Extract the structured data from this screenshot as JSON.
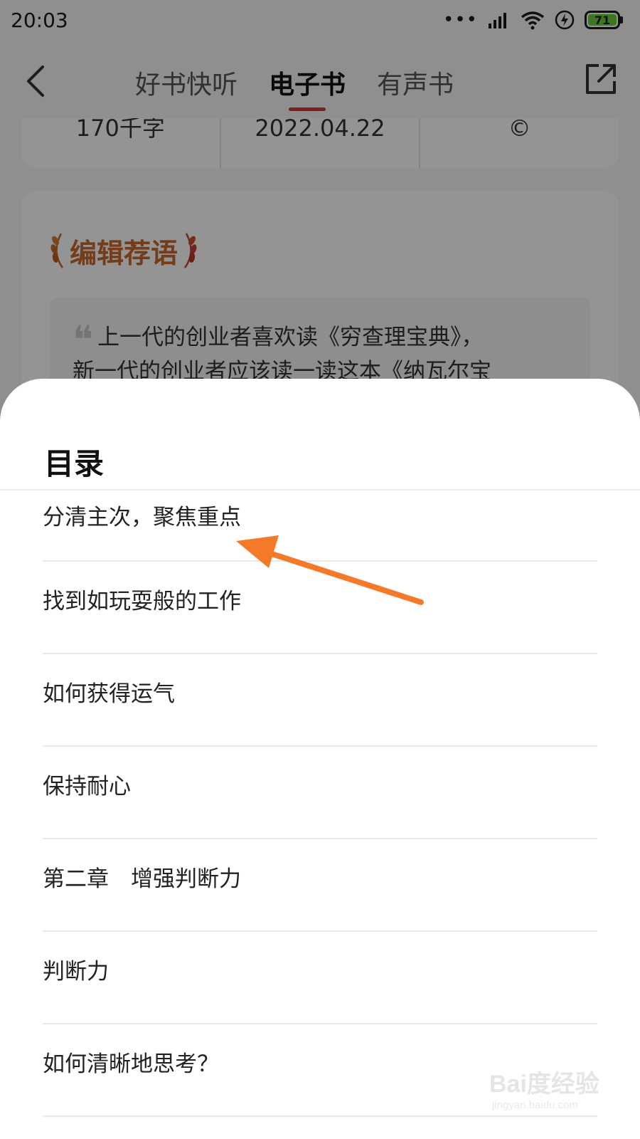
{
  "status_bar": {
    "time": "20:03",
    "battery_level": "71",
    "icons": [
      "dots-icon",
      "signal-icon",
      "wifi-icon",
      "charging-icon",
      "battery-icon"
    ]
  },
  "nav": {
    "tabs": [
      {
        "label": "好书快听",
        "active": false
      },
      {
        "label": "电子书",
        "active": true
      },
      {
        "label": "有声书",
        "active": false
      }
    ],
    "accent_color": "#d8363a"
  },
  "info": {
    "word_count": "170千字",
    "publish_date": "2022.04.22",
    "copyright_symbol": "©"
  },
  "editor_recommendation": {
    "title": "编辑荐语",
    "quote_line1": "上一代的创业者喜欢读《穷查理宝典》，",
    "quote_line2": "新一代的创业者应该读一读这本《纳瓦尔宝"
  },
  "toc": {
    "title": "目录",
    "items": [
      "分清主次，聚焦重点",
      "找到如玩耍般的工作",
      "如何获得运气",
      "保持耐心",
      "第二章　增强判断力",
      "判断力",
      "如何清晰地思考？"
    ]
  },
  "watermark": {
    "main": "Bai度经验",
    "sub": "jingyan.baidu.com"
  }
}
